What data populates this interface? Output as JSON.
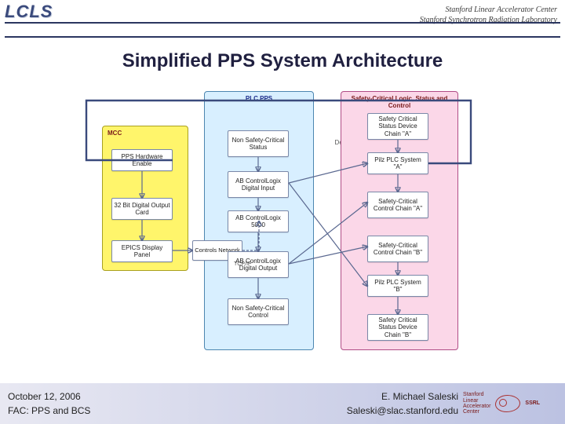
{
  "header": {
    "logo": "LCLS",
    "org_line1": "Stanford Linear Accelerator Center",
    "org_line2": "Stanford Synchrotron Radiation Laboratory"
  },
  "title": "Simplified PPS System Architecture",
  "groups": {
    "mcc": "MCC",
    "plc": "PLC PPS",
    "safe": "Safety-Critical Logic, Status and Control"
  },
  "nodes": {
    "pps": "PPS Hardware Enable",
    "bit32": "32 Bit Digital Output Card",
    "epics": "EPICS Display Panel",
    "ctlnet": "Controls Network",
    "nscstat": "Non Safety-Critical Status",
    "abin": "AB ControlLogix Digital Input",
    "ab5000": "AB ControlLogix 5000",
    "about": "AB ControlLogix Digital Output",
    "nscctl": "Non Safety-Critical Control",
    "safelog1": "Safety Critical Status Device Chain \"A\"",
    "pilzA": "Pilz PLC System \"A\"",
    "scctlA": "Safety-Critical Control Chain \"A\"",
    "scctlB": "Safety-Critical Control Chain \"B\"",
    "pilzB": "Pilz PLC System \"B\"",
    "safelog2": "Safety Critical Status Device Chain \"B\""
  },
  "conn_labels": {
    "tcpip": "TCP/IP"
  },
  "footer": {
    "date": "October 12, 2006",
    "topic": "FAC: PPS and BCS",
    "author": "E. Michael Saleski",
    "email": "Saleski@slac.stanford.edu",
    "stamp1": "Stanford",
    "stamp2": "Linear",
    "stamp3": "Accelerator",
    "stamp4": "Center",
    "ssrl": "SSRL"
  }
}
